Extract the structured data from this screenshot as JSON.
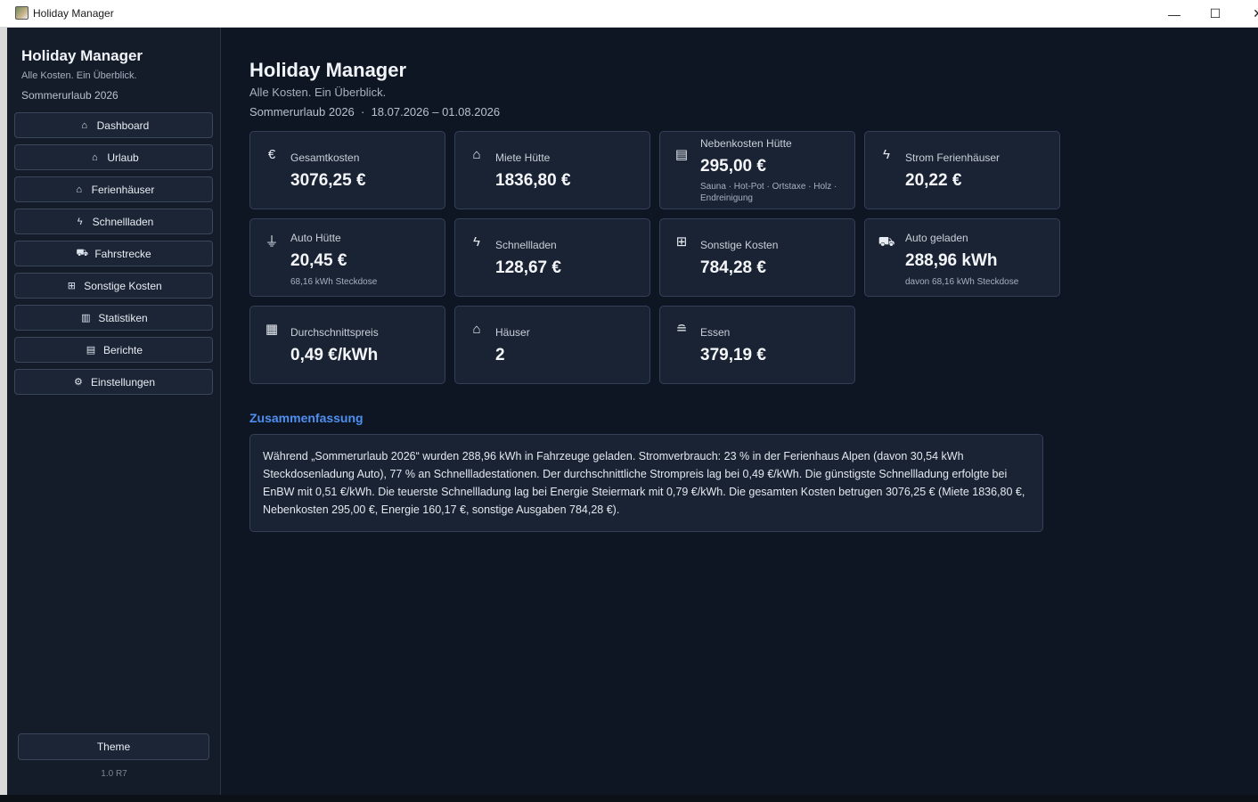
{
  "window": {
    "title": "Holiday Manager",
    "min_glyph": "—",
    "max_glyph": "☐",
    "close_glyph": "✕"
  },
  "sidebar": {
    "title": "Holiday Manager",
    "subtitle": "Alle Kosten. Ein Überblick.",
    "trip": "Sommerurlaub 2026",
    "items": [
      {
        "label": "Dashboard",
        "icon": "house-icon",
        "glyph": "⌂"
      },
      {
        "label": "Urlaub",
        "icon": "house-icon",
        "glyph": "⌂"
      },
      {
        "label": "Ferienhäuser",
        "icon": "house-icon",
        "glyph": "⌂"
      },
      {
        "label": "Schnellladen",
        "icon": "bolt-icon",
        "glyph": "ϟ"
      },
      {
        "label": "Fahrstrecke",
        "icon": "car-icon",
        "glyph": "⛟"
      },
      {
        "label": "Sonstige Kosten",
        "icon": "cart-icon",
        "glyph": "⊞"
      },
      {
        "label": "Statistiken",
        "icon": "bar-chart-icon",
        "glyph": "▥"
      },
      {
        "label": "Berichte",
        "icon": "document-icon",
        "glyph": "▤"
      },
      {
        "label": "Einstellungen",
        "icon": "gear-icon",
        "glyph": "⚙"
      }
    ],
    "theme_label": "Theme",
    "version": "1.0 R7"
  },
  "main": {
    "title": "Holiday Manager",
    "subtitle": "Alle Kosten. Ein Überblick.",
    "trip_line": "Sommerurlaub 2026  ·  18.07.2026 – 01.08.2026",
    "cards": [
      {
        "label": "Gesamtkosten",
        "value": "3076,25 €",
        "note": "",
        "icon": "euro-icon",
        "glyph": "€"
      },
      {
        "label": "Miete Hütte",
        "value": "1836,80 €",
        "note": "",
        "icon": "house-icon",
        "glyph": "⌂"
      },
      {
        "label": "Nebenkosten Hütte",
        "value": "295,00 €",
        "note": "Sauna · Hot-Pot · Ortstaxe · Holz · Endreinigung",
        "icon": "receipt-icon",
        "glyph": "▤"
      },
      {
        "label": "Strom Ferienhäuser",
        "value": "20,22 €",
        "note": "",
        "icon": "bolt-icon",
        "glyph": "ϟ"
      },
      {
        "label": "Auto Hütte",
        "value": "20,45 €",
        "note": "68,16 kWh Steckdose",
        "icon": "plug-icon",
        "glyph": "⏚"
      },
      {
        "label": "Schnellladen",
        "value": "128,67 €",
        "note": "",
        "icon": "bolt-icon",
        "glyph": "ϟ"
      },
      {
        "label": "Sonstige Kosten",
        "value": "784,28 €",
        "note": "",
        "icon": "cart-icon",
        "glyph": "⊞"
      },
      {
        "label": "Auto geladen",
        "value": "288,96 kWh",
        "note": "davon 68,16 kWh Steckdose",
        "icon": "car-icon",
        "glyph": "⛟"
      },
      {
        "label": "Durchschnittspreis",
        "value": "0,49 €/kWh",
        "note": "",
        "icon": "grid-chart-icon",
        "glyph": "▦"
      },
      {
        "label": "Häuser",
        "value": "2",
        "note": "",
        "icon": "house-icon",
        "glyph": "⌂"
      },
      {
        "label": "Essen",
        "value": "379,19 €",
        "note": "",
        "icon": "burger-icon",
        "glyph": "≘"
      }
    ],
    "summary_title": "Zusammenfassung",
    "summary_text": "Während „Sommerurlaub 2026“ wurden 288,96 kWh in Fahrzeuge geladen. Stromverbrauch: 23 % in der Ferienhaus Alpen (davon 30,54 kWh Steckdosenladung Auto), 77 % an Schnellladestationen. Der durchschnittliche Strompreis lag bei 0,49 €/kWh. Die günstigste Schnellladung erfolgte bei EnBW mit 0,51 €/kWh. Die teuerste Schnellladung lag bei Energie Steiermark mit 0,79 €/kWh. Die gesamten Kosten betrugen 3076,25 € (Miete 1836,80 €, Nebenkosten 295,00 €, Energie 160,17 €, sonstige Ausgaben 784,28 €)."
  }
}
